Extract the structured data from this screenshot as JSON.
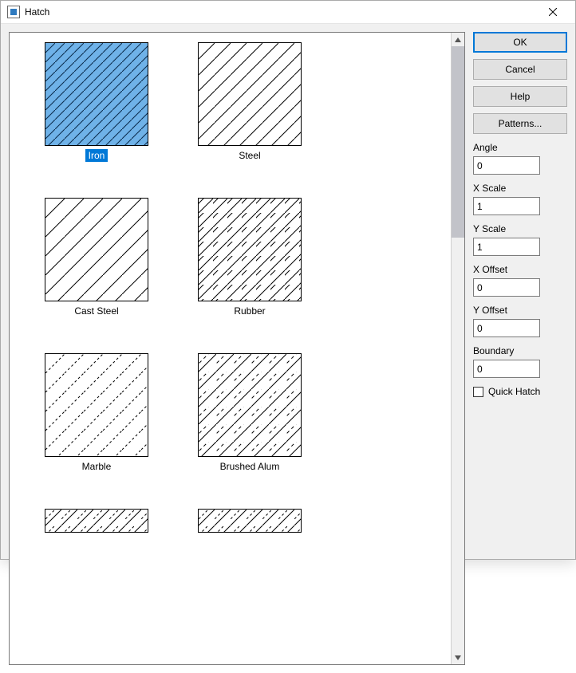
{
  "window": {
    "title": "Hatch",
    "close_icon": "close-icon"
  },
  "gallery": {
    "items": [
      {
        "label": "Iron",
        "selected": true
      },
      {
        "label": "Steel",
        "selected": false
      },
      {
        "label": "Cast Steel",
        "selected": false
      },
      {
        "label": "Rubber",
        "selected": false
      },
      {
        "label": "Marble",
        "selected": false
      },
      {
        "label": "Brushed Alum",
        "selected": false
      },
      {
        "label": "",
        "selected": false
      },
      {
        "label": "",
        "selected": false
      }
    ]
  },
  "buttons": {
    "ok": "OK",
    "cancel": "Cancel",
    "help": "Help",
    "patterns": "Patterns..."
  },
  "fields": {
    "angle": {
      "label": "Angle",
      "value": "0"
    },
    "xscale": {
      "label": "X Scale",
      "value": "1"
    },
    "yscale": {
      "label": "Y Scale",
      "value": "1"
    },
    "xoffset": {
      "label": "X Offset",
      "value": "0"
    },
    "yoffset": {
      "label": "Y Offset",
      "value": "0"
    },
    "boundary": {
      "label": "Boundary",
      "value": "0"
    }
  },
  "checkbox": {
    "quick_hatch": {
      "label": "Quick Hatch",
      "checked": false
    }
  }
}
